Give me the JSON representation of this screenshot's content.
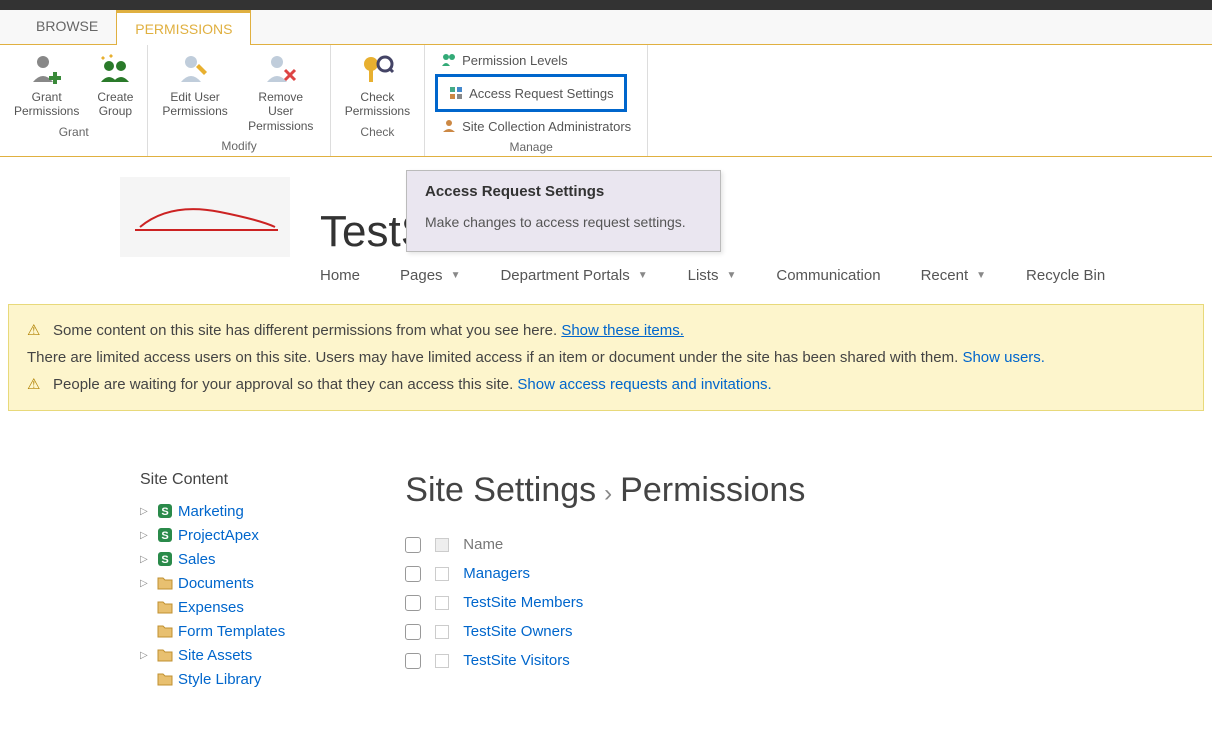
{
  "tabs": {
    "browse": "BROWSE",
    "permissions": "PERMISSIONS"
  },
  "ribbon": {
    "grant": {
      "title": "Grant",
      "grant_perms": "Grant\nPermissions",
      "create_group": "Create\nGroup"
    },
    "modify": {
      "title": "Modify",
      "edit_user": "Edit User\nPermissions",
      "remove_user": "Remove User\nPermissions"
    },
    "check": {
      "title": "Check",
      "check_perms": "Check\nPermissions"
    },
    "manage": {
      "title": "Manage",
      "perm_levels": "Permission Levels",
      "access_req": "Access Request Settings",
      "site_admins": "Site Collection Administrators"
    }
  },
  "tooltip": {
    "title": "Access Request Settings",
    "desc": "Make changes to access request settings."
  },
  "site": {
    "title": "TestSite"
  },
  "nav": {
    "home": "Home",
    "pages": "Pages",
    "dept": "Department Portals",
    "lists": "Lists",
    "comm": "Communication",
    "recent": "Recent",
    "recycle": "Recycle Bin"
  },
  "notice": {
    "line1a": "Some content on this site has different permissions from what you see here.",
    "line1link": "Show these items.",
    "line2a": "There are limited access users on this site. Users may have limited access if an item or document under the site has been shared with them.",
    "line2link": "Show users.",
    "line3a": "People are waiting for your approval so that they can access this site.",
    "line3link": "Show access requests and invitations."
  },
  "left": {
    "title": "Site Content",
    "items": [
      {
        "label": "Marketing",
        "icon": "s",
        "caret": true
      },
      {
        "label": "ProjectApex",
        "icon": "s",
        "caret": true
      },
      {
        "label": "Sales",
        "icon": "s",
        "caret": true
      },
      {
        "label": "Documents",
        "icon": "f",
        "caret": true
      },
      {
        "label": "Expenses",
        "icon": "f",
        "caret": false
      },
      {
        "label": "Form Templates",
        "icon": "f",
        "caret": false
      },
      {
        "label": "Site Assets",
        "icon": "f",
        "caret": true
      },
      {
        "label": "Style Library",
        "icon": "f",
        "caret": false
      }
    ]
  },
  "breadcrumb": {
    "a": "Site Settings",
    "b": "Permissions"
  },
  "perms": {
    "header": "Name",
    "rows": [
      "Managers",
      "TestSite Members",
      "TestSite Owners",
      "TestSite Visitors"
    ]
  }
}
